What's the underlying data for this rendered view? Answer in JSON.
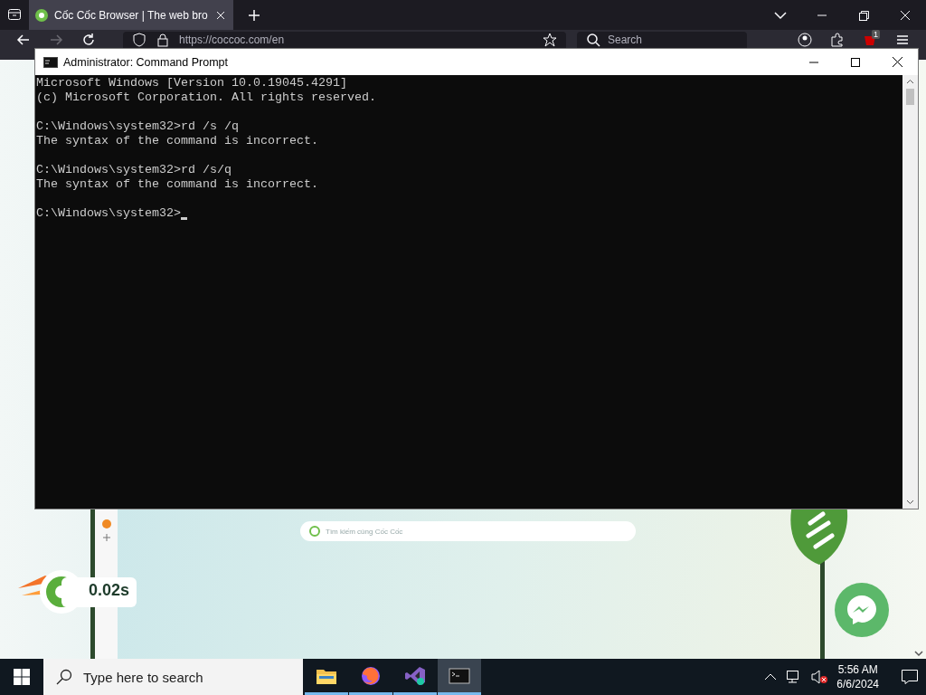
{
  "browser": {
    "tab": {
      "title": "Cốc Cốc Browser | The web bro",
      "selected": true
    },
    "address": "https://coccoc.com/en",
    "search_placeholder": "Search",
    "extension_badge": "1"
  },
  "page": {
    "search_placeholder": "Tìm kiếm cùng Cốc Cốc",
    "speed": "0.02s"
  },
  "console_window": {
    "title": "Administrator: Command Prompt",
    "blocks": [
      [
        "Microsoft Windows [Version 10.0.19045.4291]",
        "(c) Microsoft Corporation. All rights reserved."
      ],
      [
        "C:\\Windows\\system32>rd /s /q",
        "The syntax of the command is incorrect."
      ],
      [
        "C:\\Windows\\system32>rd /s/q",
        "The syntax of the command is incorrect."
      ],
      [
        "C:\\Windows\\system32>"
      ]
    ]
  },
  "taskbar": {
    "search_placeholder": "Type here to search",
    "apps": [
      {
        "kind": "files",
        "selected": false
      },
      {
        "kind": "firefox",
        "selected": false
      },
      {
        "kind": "studio",
        "selected": false
      },
      {
        "kind": "terminal",
        "selected": true
      }
    ],
    "time": "5:56 AM",
    "date": "6/6/2024"
  }
}
